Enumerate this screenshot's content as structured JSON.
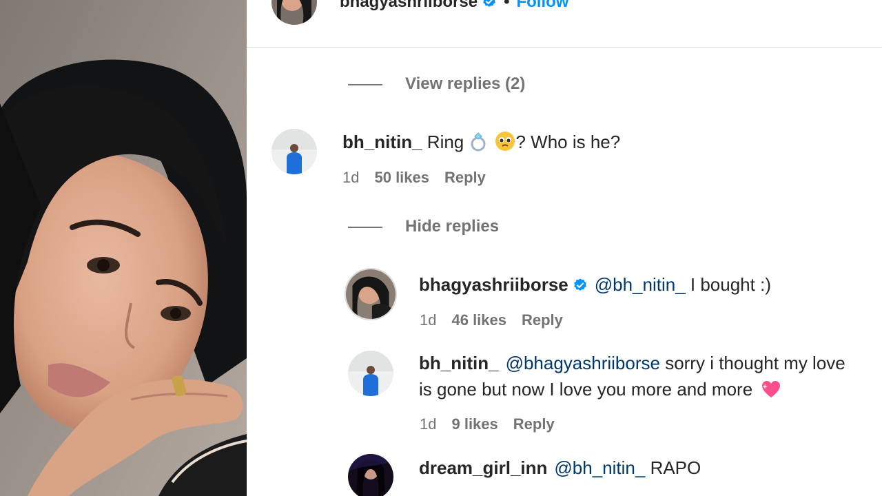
{
  "post": {
    "author": "bhagyashriiborse",
    "follow_label": "Follow",
    "separator": "•"
  },
  "comments": [
    {
      "toggle_label": "View replies (2)"
    },
    {
      "username": "bh_nitin_",
      "text_pre": " Ring ",
      "text_post": "? Who is he?",
      "time": "1d",
      "likes": "50 likes",
      "reply_label": "Reply",
      "toggle_label": "Hide replies",
      "replies": [
        {
          "username": "bhagyashriiborse",
          "mention": "@bh_nitin_",
          "text": " I bought :)",
          "time": "1d",
          "likes": "46 likes",
          "reply_label": "Reply"
        },
        {
          "username": "bh_nitin_",
          "mention": "@bhagyashriiborse",
          "text_line1": " sorry i thought my love",
          "text_line2": "is gone but now I love you more and more",
          "time": "1d",
          "likes": "9 likes",
          "reply_label": "Reply"
        },
        {
          "username": "dream_girl_inn",
          "mention": "@bh_nitin_",
          "text": " RAPO"
        }
      ]
    }
  ],
  "colors": {
    "link": "#0095f6",
    "mention": "#00376b",
    "muted": "#737373",
    "verified": "#0095f6"
  }
}
